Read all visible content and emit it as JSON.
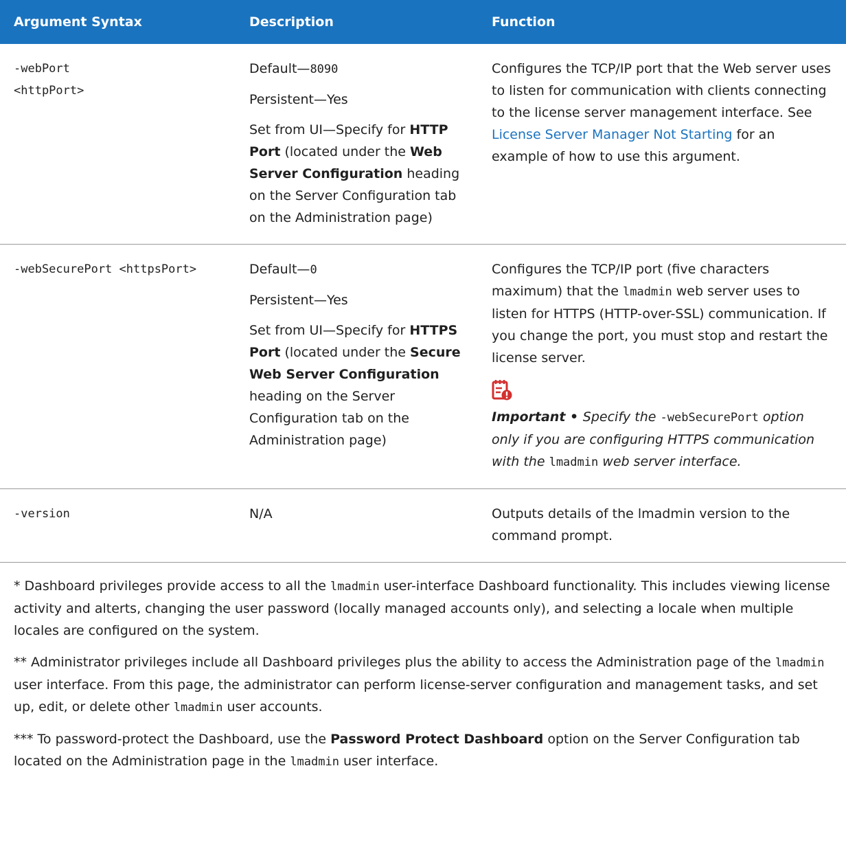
{
  "table": {
    "headers": [
      "Argument Syntax",
      "Description",
      "Function"
    ],
    "rows": [
      {
        "syntax_line1": "-webPort",
        "syntax_line2": "<httpPort>",
        "default_label": "Default—",
        "default_value": "8090",
        "persistent": "Persistent—Yes",
        "set_from_ui_prefix": "Set from UI—Specify for ",
        "set_from_ui_bold1": "HTTP Port",
        "set_from_ui_mid": " (located under the ",
        "set_from_ui_bold2": "Web Server Configuration",
        "set_from_ui_suffix": " heading on the Server Configuration tab on the Administration page)",
        "function_prefix": "Configures the TCP/IP port that the Web server uses to listen for communication with clients connecting to the license server management interface. See ",
        "function_link": "License Server Manager Not Starting",
        "function_suffix": " for an example of how to use this argument."
      },
      {
        "syntax": "-webSecurePort <httpsPort>",
        "default_label": "Default—",
        "default_value": "0",
        "persistent": "Persistent—Yes",
        "set_from_ui_prefix": "Set from UI—Specify for ",
        "set_from_ui_bold1": "HTTPS Port",
        "set_from_ui_mid": " (located under the ",
        "set_from_ui_bold2": "Secure Web Server Configuration",
        "set_from_ui_suffix": " heading on the Server Configuration tab on the Administration page)",
        "function_prefix": "Configures the TCP/IP port (five characters maximum) that the ",
        "function_code": "lmadmin",
        "function_suffix": " web server uses to listen for HTTPS (HTTP-over-SSL) communication. If you change the port, you must stop and restart the license server.",
        "note_icon": "important-note-icon",
        "note_label": "Important • ",
        "note_text1": "Specify the ",
        "note_code1": "-webSecurePort",
        "note_text2": " option only if you are configuring HTTPS communication with the ",
        "note_code2": "lmadmin",
        "note_text3": " web server interface."
      },
      {
        "syntax": "-version",
        "description": "N/A",
        "function": "Outputs details of the lmadmin version to the command prompt."
      }
    ]
  },
  "footnotes": {
    "fn1_prefix": "* Dashboard privileges provide access to all the ",
    "fn1_code": "lmadmin",
    "fn1_suffix": " user-interface Dashboard functionality. This includes viewing license activity and alterts, changing the user password (locally managed accounts only), and selecting a locale when multiple locales are configured on the system.",
    "fn2_prefix": "** Administrator privileges include all Dashboard privileges plus the ability to access the Administration page of the ",
    "fn2_code1": "lmadmin",
    "fn2_mid": " user interface. From this page, the administrator can perform license-server configuration and management tasks, and set up, edit, or delete other ",
    "fn2_code2": "lmadmin",
    "fn2_suffix": " user accounts.",
    "fn3_prefix": "*** To password-protect the Dashboard, use the ",
    "fn3_bold": "Password Protect Dashboard",
    "fn3_mid": " option on the Server Configuration tab located on the Administration page in the ",
    "fn3_code": "lmadmin",
    "fn3_suffix": " user interface."
  },
  "colors": {
    "header_bg": "#1a73bf",
    "link": "#1a73bf",
    "icon": "#d32f2f"
  }
}
